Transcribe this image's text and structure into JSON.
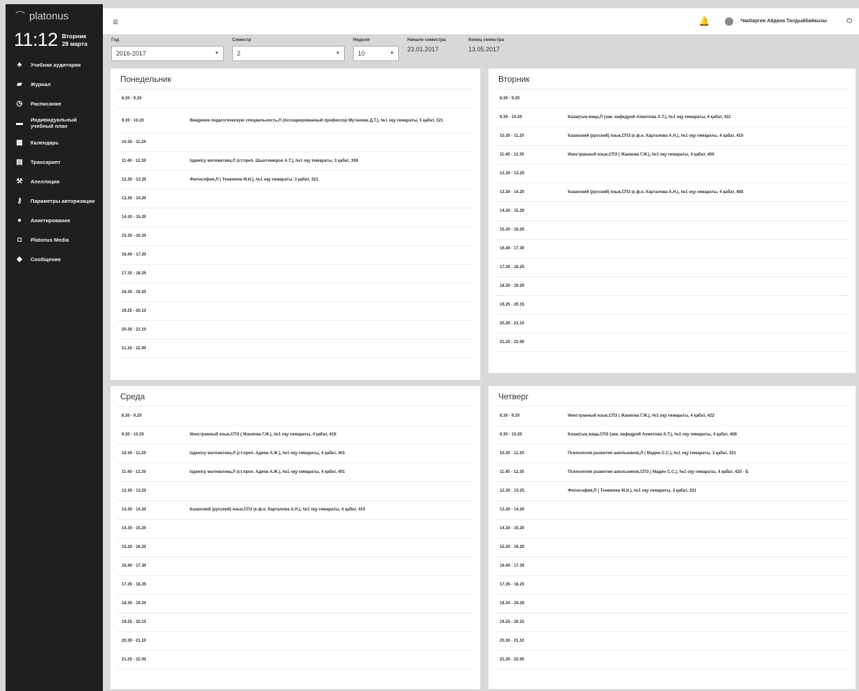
{
  "app": {
    "logo": "platonus",
    "time": "11:12",
    "weekday": "Вторник",
    "date": "28 марта"
  },
  "sidebar": {
    "items": [
      {
        "label": "Учебная аудитория",
        "icon": "users-icon"
      },
      {
        "label": "Журнал",
        "icon": "book-icon"
      },
      {
        "label": "Расписание",
        "icon": "clock-icon"
      },
      {
        "label": "Индивидуальный учебный план",
        "icon": "credit-card-icon"
      },
      {
        "label": "Календарь",
        "icon": "calendar-icon"
      },
      {
        "label": "Транскрипт",
        "icon": "table-icon"
      },
      {
        "label": "Апелляция",
        "icon": "gavel-icon"
      },
      {
        "label": "Параметры авторизации",
        "icon": "key-icon"
      },
      {
        "label": "Анкетирование",
        "icon": "info-icon"
      },
      {
        "label": "Platonus Media",
        "icon": "media-icon"
      },
      {
        "label": "Сообщения",
        "icon": "chat-icon"
      }
    ]
  },
  "header": {
    "username": "Чакбаргин Айдана Талдыйбайкызы"
  },
  "filters": {
    "year_label": "Год",
    "year_value": "2016-2017",
    "semester_label": "Семестр",
    "semester_value": "2",
    "week_label": "Неделя",
    "week_value": "10",
    "start_label": "Начало семестра",
    "start_value": "23.01.2017",
    "end_label": "Конец семестра",
    "end_value": "13.05.2017"
  },
  "days": [
    {
      "name": "Понедельник",
      "rows": [
        {
          "time": "8.30 - 9.20",
          "lesson": ""
        },
        {
          "time": "9.30 - 10.20",
          "lesson": "Введение педагогическую специальность,Л (Ассоциированный профессор Мутанова Д.Т.), №1 оқу ғимараты, 3 қабат, 321"
        },
        {
          "time": "10.30 - 11.20",
          "lesson": ""
        },
        {
          "time": "11.40 - 12.30",
          "lesson": "Ізденісу математика,Л (ст.преп. Шынтемиров А.Т.), №1 оқу ғимараты, 3 қабат, 308"
        },
        {
          "time": "12.30 - 13.25",
          "lesson": "Философия,Л ( Тенемоев М.И.), №1 оқу ғимараты, 3 қабат, 321"
        },
        {
          "time": "13.30 - 14.20",
          "lesson": ""
        },
        {
          "time": "14.30 - 15.20",
          "lesson": ""
        },
        {
          "time": "15.30 - 16.20",
          "lesson": ""
        },
        {
          "time": "16.40 - 17.30",
          "lesson": ""
        },
        {
          "time": "17.35 - 18.25",
          "lesson": ""
        },
        {
          "time": "18.30 - 19.20",
          "lesson": ""
        },
        {
          "time": "19.25 - 20.15",
          "lesson": ""
        },
        {
          "time": "20.30 - 21.10",
          "lesson": ""
        },
        {
          "time": "21.20 - 22.00",
          "lesson": ""
        }
      ]
    },
    {
      "name": "Вторник",
      "rows": [
        {
          "time": "8.30 - 9.20",
          "lesson": ""
        },
        {
          "time": "9.30 - 10.20",
          "lesson": "Казақтың жаңа,Л (зав. кафедрой Ахметова А.Т.), №1 оқу ғимараты, 4 қабат, 411"
        },
        {
          "time": "10.30 - 11.20",
          "lesson": "Казахский (русский) язык,СПЗ (к.ф.н. Карталова А.Н.), №1 оқу ғимараты, 4 қабат, 410"
        },
        {
          "time": "11.40 - 12.30",
          "lesson": "Иностранный язык,СПЗ ( Жанкова Г.Ж.), №1 оқу ғимараты, 4 қабат, 400"
        },
        {
          "time": "12.30 - 13.25",
          "lesson": ""
        },
        {
          "time": "13.30 - 14.20",
          "lesson": "Казахский (русский) язык,СПЗ (к.ф.н. Карталова А.Н.), №1 оқу ғимараты, 4 қабат, 408"
        },
        {
          "time": "14.30 - 15.20",
          "lesson": ""
        },
        {
          "time": "15.30 - 16.20",
          "lesson": ""
        },
        {
          "time": "16.40 - 17.30",
          "lesson": ""
        },
        {
          "time": "17.35 - 18.25",
          "lesson": ""
        },
        {
          "time": "18.30 - 19.20",
          "lesson": ""
        },
        {
          "time": "19.25 - 20.15",
          "lesson": ""
        },
        {
          "time": "20.30 - 21.10",
          "lesson": ""
        },
        {
          "time": "21.20 - 22.00",
          "lesson": ""
        }
      ]
    },
    {
      "name": "Среда",
      "rows": [
        {
          "time": "8.30 - 9.20",
          "lesson": ""
        },
        {
          "time": "9.30 - 10.20",
          "lesson": "Иностранный язык,СПЗ ( Жанкова Г.Ж.), №1 оқу ғимараты, 4 қабат, 416"
        },
        {
          "time": "10.30 - 11.20",
          "lesson": "Ізденісу математика,Л (ст.преп. Адиев А.Ж.), №1 оқу ғимараты, 4 қабат, 401"
        },
        {
          "time": "11.40 - 12.30",
          "lesson": "Ізденісу математика,Л (ст.преп. Адиев А.Ж.), №1 оқу ғимараты, 4 қабат, 401"
        },
        {
          "time": "12.30 - 13.25",
          "lesson": ""
        },
        {
          "time": "13.30 - 14.20",
          "lesson": "Казахский (русский) язык,СПЗ (к.ф.н. Карталова А.Н.), №1 оқу ғимараты, 4 қабат, 410"
        },
        {
          "time": "14.30 - 15.20",
          "lesson": ""
        },
        {
          "time": "15.30 - 16.20",
          "lesson": ""
        },
        {
          "time": "16.40 - 17.30",
          "lesson": ""
        },
        {
          "time": "17.35 - 18.25",
          "lesson": ""
        },
        {
          "time": "18.30 - 19.20",
          "lesson": ""
        },
        {
          "time": "19.25 - 20.15",
          "lesson": ""
        },
        {
          "time": "20.30 - 21.10",
          "lesson": ""
        },
        {
          "time": "21.20 - 22.00",
          "lesson": ""
        }
      ]
    },
    {
      "name": "Четверг",
      "rows": [
        {
          "time": "8.30 - 9.20",
          "lesson": "Иностранный язык,СПЗ ( Жанкова Г.Ж.), №1 оқу ғимараты, 4 қабат, 422"
        },
        {
          "time": "9.30 - 10.20",
          "lesson": "Казақтың жаңа,СПЗ (зав. кафедрой Ахметова А.Т.), №1 оқу ғимараты, 4 қабат, 408"
        },
        {
          "time": "10.30 - 11.20",
          "lesson": "Психология развития школьников,Л ( Мадин С.С.), №1 оқу ғимараты, 3 қабат, 321"
        },
        {
          "time": "11.40 - 12.30",
          "lesson": "Психология развития школьников,СПЗ ( Мадин С.С.), №1 оқу ғимараты, 4 қабат, 425 - Б"
        },
        {
          "time": "12.30 - 13.25",
          "lesson": "Философия,Л ( Тенемоев М.И.), №1 оқу ғимараты, 3 қабат, 321"
        },
        {
          "time": "13.30 - 14.20",
          "lesson": ""
        },
        {
          "time": "14.30 - 15.20",
          "lesson": ""
        },
        {
          "time": "15.30 - 16.20",
          "lesson": ""
        },
        {
          "time": "16.40 - 17.30",
          "lesson": ""
        },
        {
          "time": "17.35 - 18.25",
          "lesson": ""
        },
        {
          "time": "18.30 - 19.20",
          "lesson": ""
        },
        {
          "time": "19.25 - 20.15",
          "lesson": ""
        },
        {
          "time": "20.30 - 21.10",
          "lesson": ""
        },
        {
          "time": "21.20 - 22.00",
          "lesson": ""
        }
      ]
    }
  ]
}
